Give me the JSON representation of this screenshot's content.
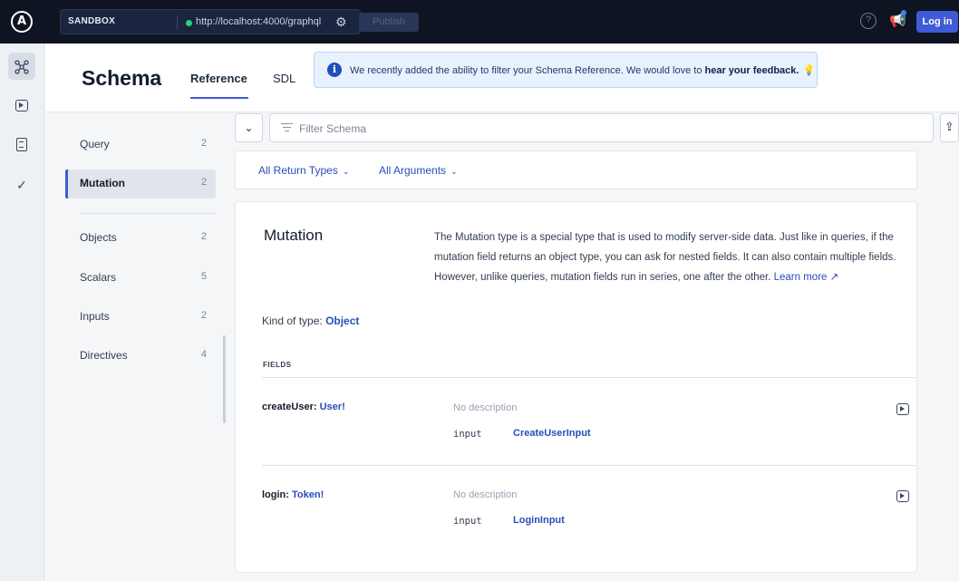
{
  "topbar": {
    "logo": "A",
    "sandbox_tag": "SANDBOX",
    "url": "http://localhost:4000/graphql",
    "publish_label": "Publish",
    "help_glyph": "?",
    "login_label": "Log in"
  },
  "header": {
    "title": "Schema",
    "tabs": [
      {
        "label": "Reference"
      },
      {
        "label": "SDL"
      }
    ],
    "notice": {
      "icon_glyph": "i",
      "text": "We recently added the ability to filter your Schema Reference. We would love to ",
      "bold": "hear your feedback.",
      "emoji": "💡"
    }
  },
  "sidebar": {
    "items": [
      {
        "label": "Query",
        "count": "2"
      },
      {
        "label": "Mutation",
        "count": "2"
      },
      {
        "label": "Objects",
        "count": "2"
      },
      {
        "label": "Scalars",
        "count": "5"
      },
      {
        "label": "Inputs",
        "count": "2"
      },
      {
        "label": "Directives",
        "count": "4"
      }
    ]
  },
  "filter": {
    "placeholder": "Filter Schema",
    "value": "",
    "collapse_glyph": "⌄",
    "share_glyph": "⇪",
    "return_types": "All Return Types",
    "arguments": "All Arguments"
  },
  "type": {
    "name": "Mutation",
    "description": "The Mutation type is a special type that is used to modify server-side data. Just like in queries, if the mutation field returns an object type, you can ask for nested fields. It can also contain multiple fields. However, unlike queries, mutation fields run in series, one after the other.",
    "learn_more": "Learn more",
    "learn_more_glyph": "↗",
    "kind_label": "Kind of type:",
    "kind_value": "Object",
    "fields_label": "FIELDS",
    "fields": [
      {
        "name": "createUser:",
        "type": "User!",
        "description": "No description",
        "arg_name": "input",
        "arg_type": "CreateUserInput"
      },
      {
        "name": "login:",
        "type": "Token!",
        "description": "No description",
        "arg_name": "input",
        "arg_type": "LoginInput"
      }
    ]
  },
  "colors": {
    "topbar_bg": "#0f1422",
    "accent": "#3f5bd8",
    "link": "#2a4db8",
    "status_dot": "#2ecf80"
  },
  "icons": {
    "rail": [
      "explorer-icon",
      "run-icon",
      "docs-icon",
      "checks-icon"
    ]
  }
}
